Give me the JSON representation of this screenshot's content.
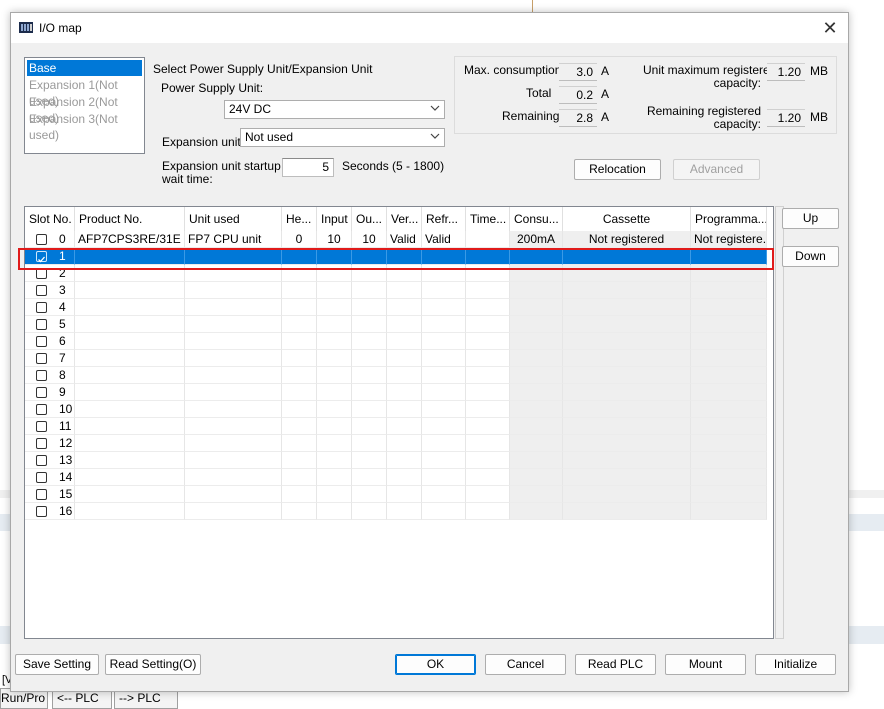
{
  "background": {
    "tabs": [
      "Run/Pro",
      "<-- PLC",
      "--> PLC"
    ],
    "side_char": "[V"
  },
  "dialog": {
    "title": "I/O map",
    "close_label": "✕"
  },
  "unit_list": [
    "Base",
    "Expansion 1(Not used)",
    "Expansion 2(Not used)",
    "Expansion 3(Not used)"
  ],
  "power": {
    "section_label": "Select Power Supply Unit/Expansion Unit",
    "psu_label": "Power Supply Unit:",
    "psu_value": "24V DC",
    "expansion_label": "Expansion unit:",
    "expansion_value": "Not used",
    "startup_label_1": "Expansion unit startup",
    "startup_label_2": "wait time:",
    "startup_value": "5",
    "startup_unit": "Seconds (5 - 1800)"
  },
  "consumption": {
    "max_label": "Max. consumption",
    "max_value": "3.0",
    "total_label": "Total",
    "total_value": "0.2",
    "remaining_label": "Remaining",
    "remaining_value": "2.8",
    "unit": "A"
  },
  "capacity": {
    "max_label_1": "Unit maximum registered",
    "max_label_2": "capacity:",
    "max_value": "1.20",
    "rem_label_1": "Remaining registered",
    "rem_label_2": "capacity:",
    "rem_value": "1.20",
    "unit": "MB"
  },
  "buttons": {
    "relocation": "Relocation",
    "advanced": "Advanced",
    "up": "Up",
    "down": "Down",
    "save_setting": "Save Setting",
    "read_setting": "Read Setting(O)",
    "ok": "OK",
    "cancel": "Cancel",
    "read_plc": "Read PLC",
    "mount": "Mount",
    "initialize": "Initialize"
  },
  "grid": {
    "columns": [
      "Slot No.",
      "Product No.",
      "Unit used",
      "He...",
      "Input",
      "Ou...",
      "Ver...",
      "Refr...",
      "Time...",
      "Consu...",
      "Cassette",
      "Programma..."
    ],
    "row0": [
      "0",
      "AFP7CPS3RE/31E",
      "FP7 CPU unit",
      "0",
      "10",
      "10",
      "Valid",
      "Valid",
      "",
      "200mA",
      "Not registered",
      "Not registere."
    ],
    "slots": [
      "1",
      "2",
      "3",
      "4",
      "5",
      "6",
      "7",
      "8",
      "9",
      "10",
      "11",
      "12",
      "13",
      "14",
      "15",
      "16"
    ],
    "selected_slot": "1"
  }
}
